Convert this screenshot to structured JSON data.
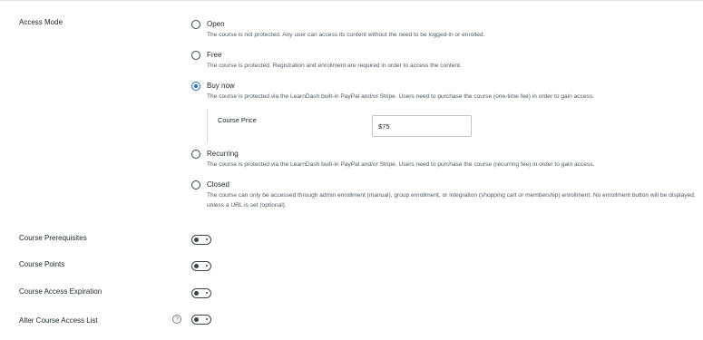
{
  "access_mode": {
    "label": "Access Mode",
    "options": [
      {
        "title": "Open",
        "desc": "The course is not protected. Any user can access its content without the need to be logged-in or enrolled."
      },
      {
        "title": "Free",
        "desc": "The course is protected. Registration and enrollment are required in order to access the content."
      },
      {
        "title": "Buy now",
        "desc": "The course is protected via the LearnDash built-in PayPal and/or Stripe. Users need to purchase the course (one-time fee) in order to gain access."
      },
      {
        "title": "Recurring",
        "desc": "The course is protected via the LearnDash built-in PayPal and/or Stripe. Users need to purchase the course (recurring fee) in order to gain access."
      },
      {
        "title": "Closed",
        "desc": "The course can only be accessed through admin enrollment (manual), group enrollment, or integration (shopping cart or membership) enrollment. No enrollment button will be displayed, unless a URL is set (optional)."
      }
    ],
    "selected": "Buy now"
  },
  "course_price": {
    "label": "Course Price",
    "value": "$75"
  },
  "settings": {
    "prerequisites": {
      "label": "Course Prerequisites",
      "enabled": false
    },
    "points": {
      "label": "Course Points",
      "enabled": false
    },
    "expiration": {
      "label": "Course Access Expiration",
      "enabled": false
    },
    "alter_list": {
      "label": "Alter Course Access List",
      "enabled": false,
      "help_icon": "?"
    }
  }
}
